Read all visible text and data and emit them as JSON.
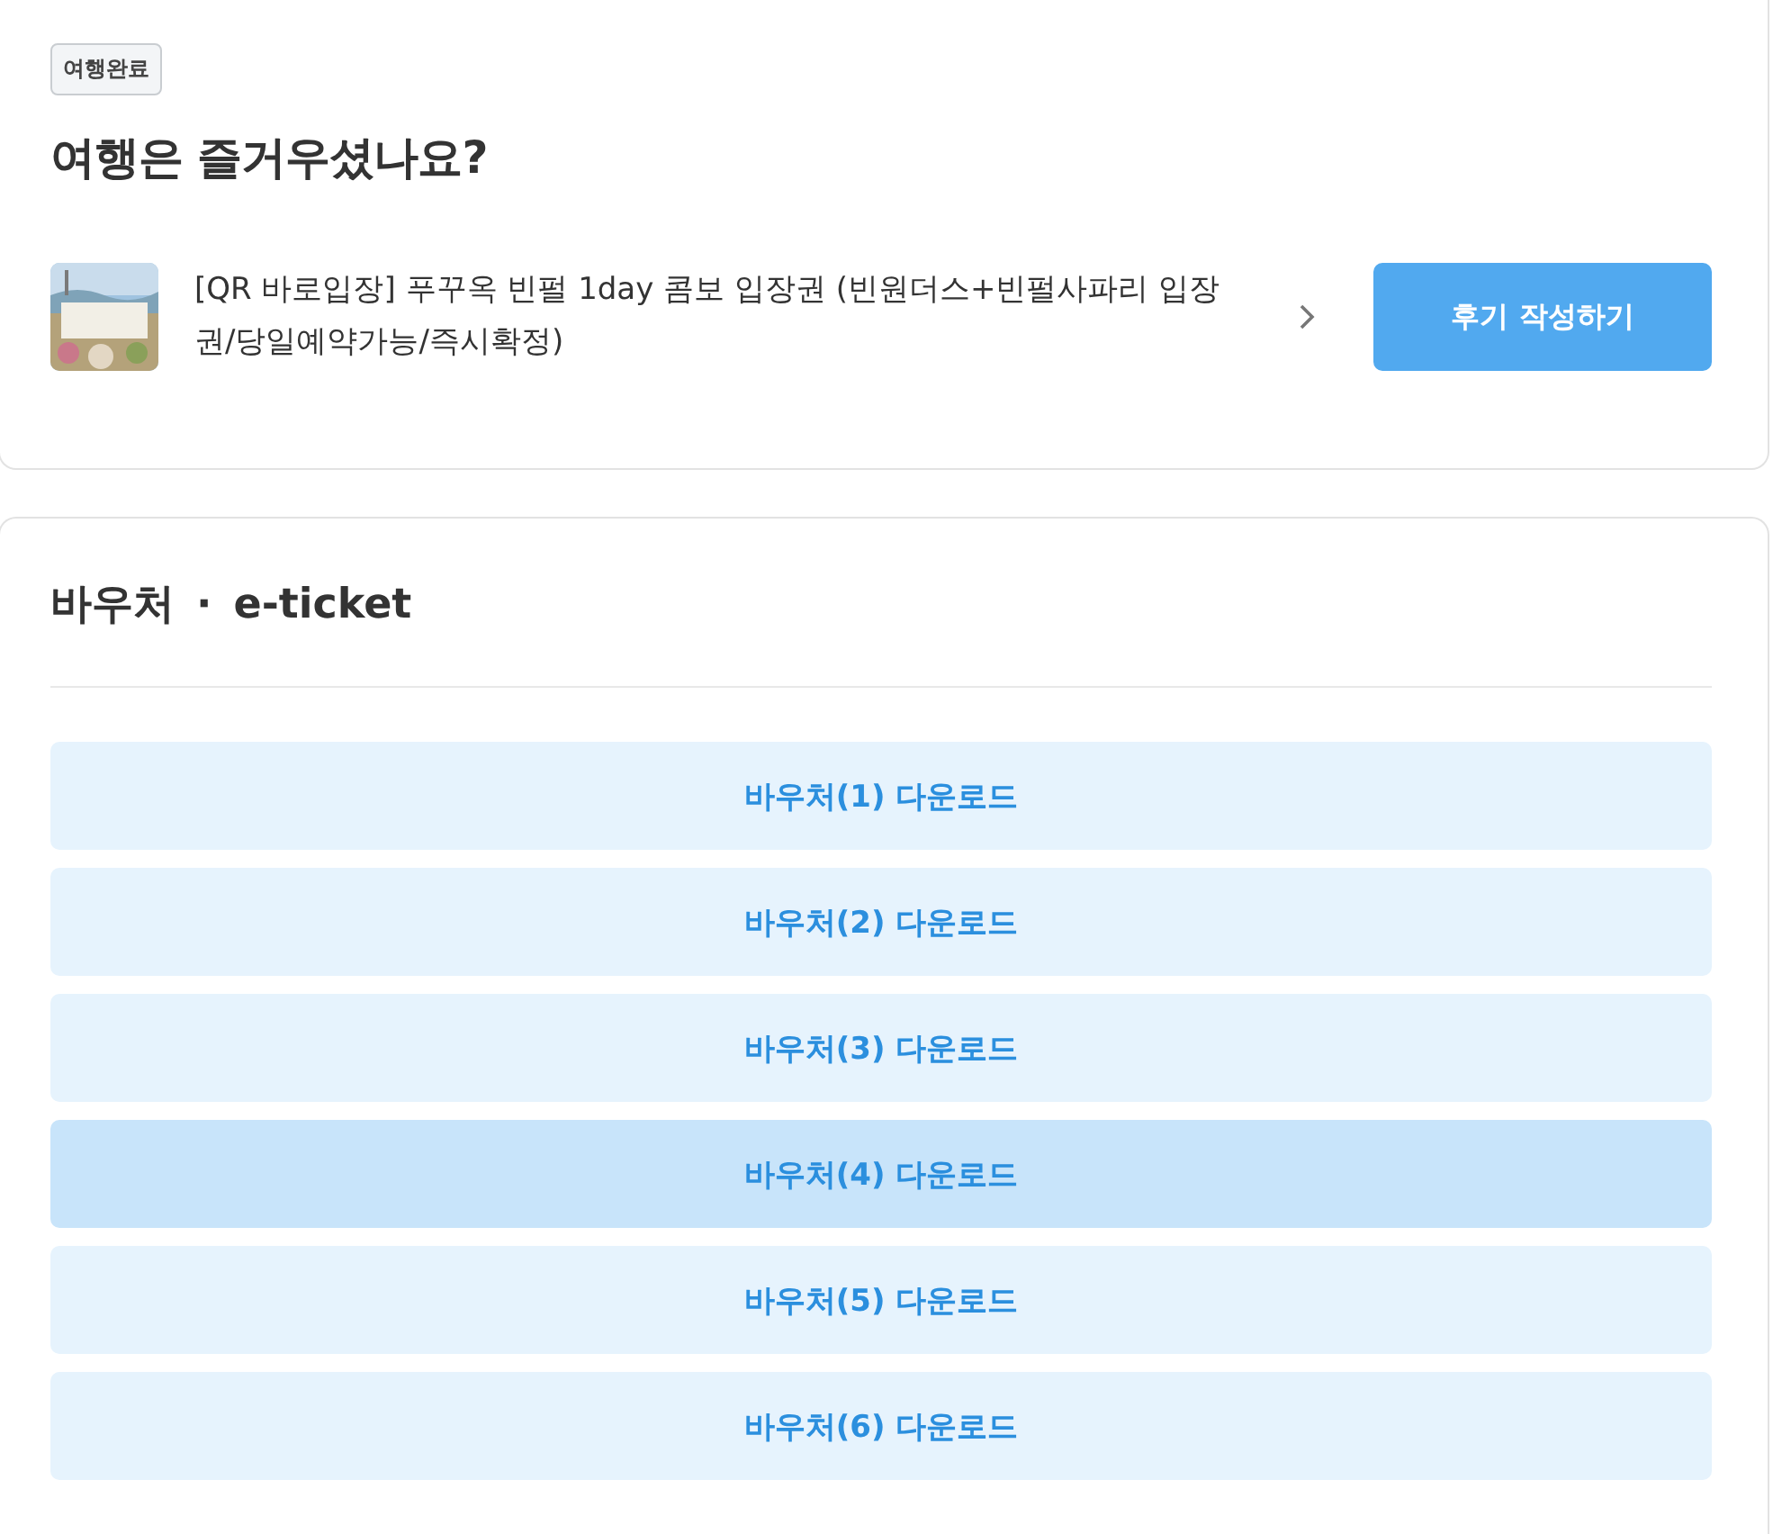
{
  "trip_card": {
    "status_badge": "여행완료",
    "heading": "여행은 즐거우셨나요?",
    "product": {
      "title": "[QR 바로입장] 푸꾸옥 빈펄 1day 콤보 입장권 (빈원더스+빈펄사파리 입장권/당일예약가능/즉시확정)"
    },
    "review_button": "후기 작성하기"
  },
  "voucher_card": {
    "title_left": "바우처",
    "separator": "·",
    "title_right": "e-ticket",
    "buttons": [
      {
        "label": "바우처(1) 다운로드",
        "selected": false
      },
      {
        "label": "바우처(2) 다운로드",
        "selected": false
      },
      {
        "label": "바우처(3) 다운로드",
        "selected": false
      },
      {
        "label": "바우처(4) 다운로드",
        "selected": true
      },
      {
        "label": "바우처(5) 다운로드",
        "selected": false
      },
      {
        "label": "바우처(6) 다운로드",
        "selected": false
      }
    ]
  }
}
